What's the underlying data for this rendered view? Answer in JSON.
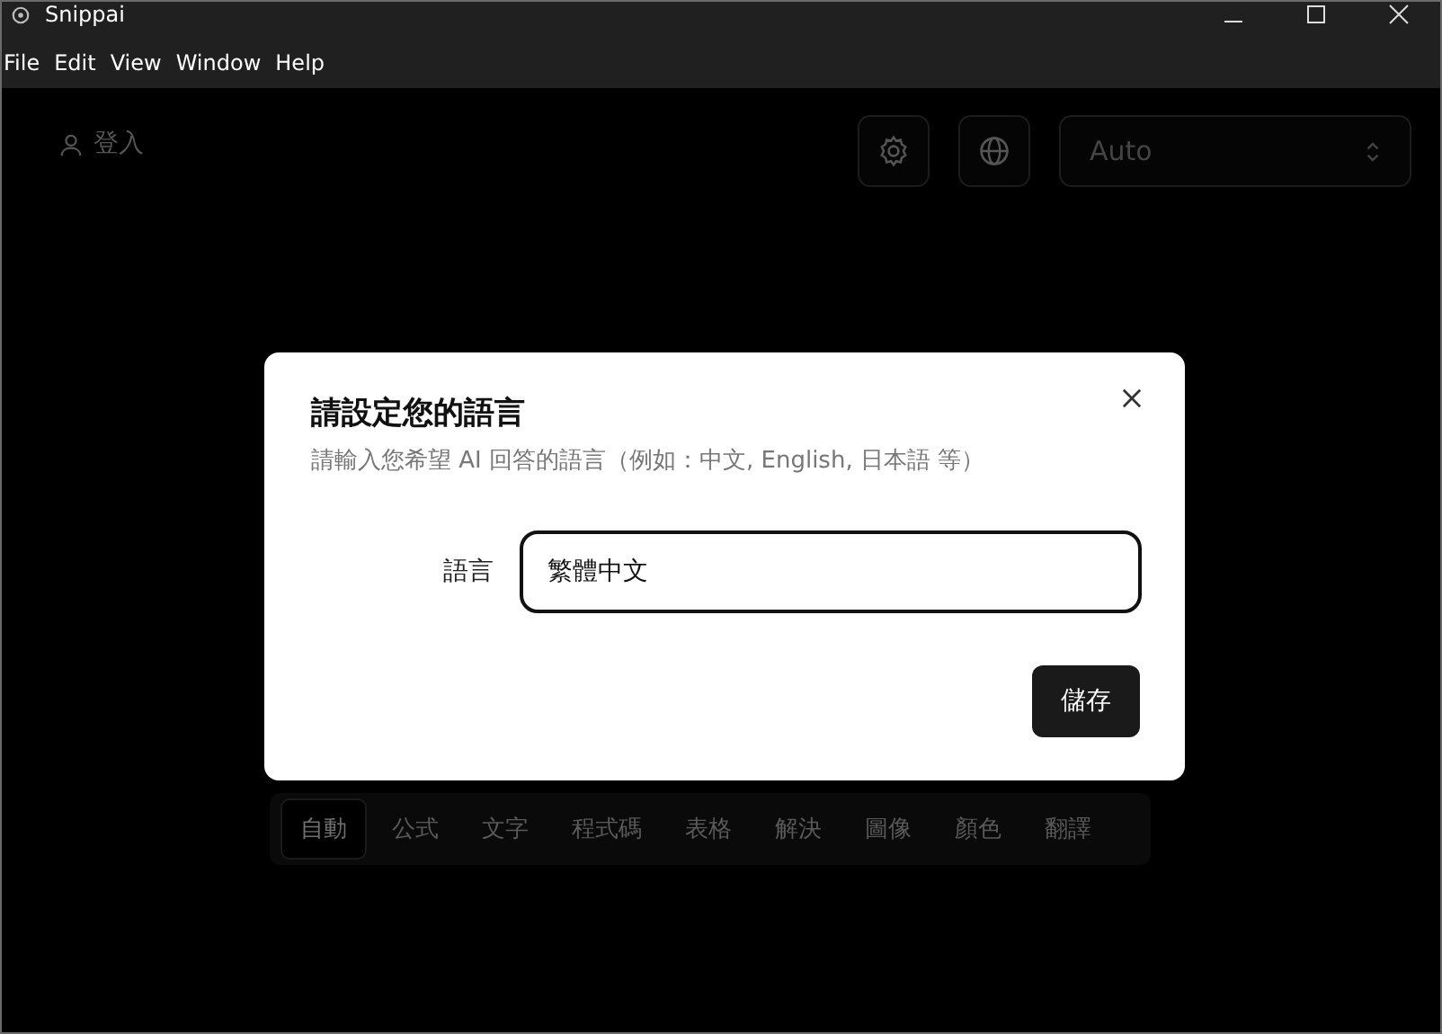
{
  "window": {
    "title": "Snippai"
  },
  "menu": [
    "File",
    "Edit",
    "View",
    "Window",
    "Help"
  ],
  "toolbar": {
    "login": "登入",
    "mode_select": {
      "value": "Auto"
    }
  },
  "dialog": {
    "title": "請設定您的語言",
    "description": "請輸入您希望 AI 回答的語言（例如：中文, English, 日本語 等）",
    "field_label": "語言",
    "field_value": "繁體中文",
    "save_button": "儲存"
  },
  "tabs": [
    {
      "label": "自動",
      "selected": true
    },
    {
      "label": "公式",
      "selected": false
    },
    {
      "label": "文字",
      "selected": false
    },
    {
      "label": "程式碼",
      "selected": false
    },
    {
      "label": "表格",
      "selected": false
    },
    {
      "label": "解決",
      "selected": false
    },
    {
      "label": "圖像",
      "selected": false
    },
    {
      "label": "顏色",
      "selected": false
    },
    {
      "label": "翻譯",
      "selected": false
    }
  ]
}
